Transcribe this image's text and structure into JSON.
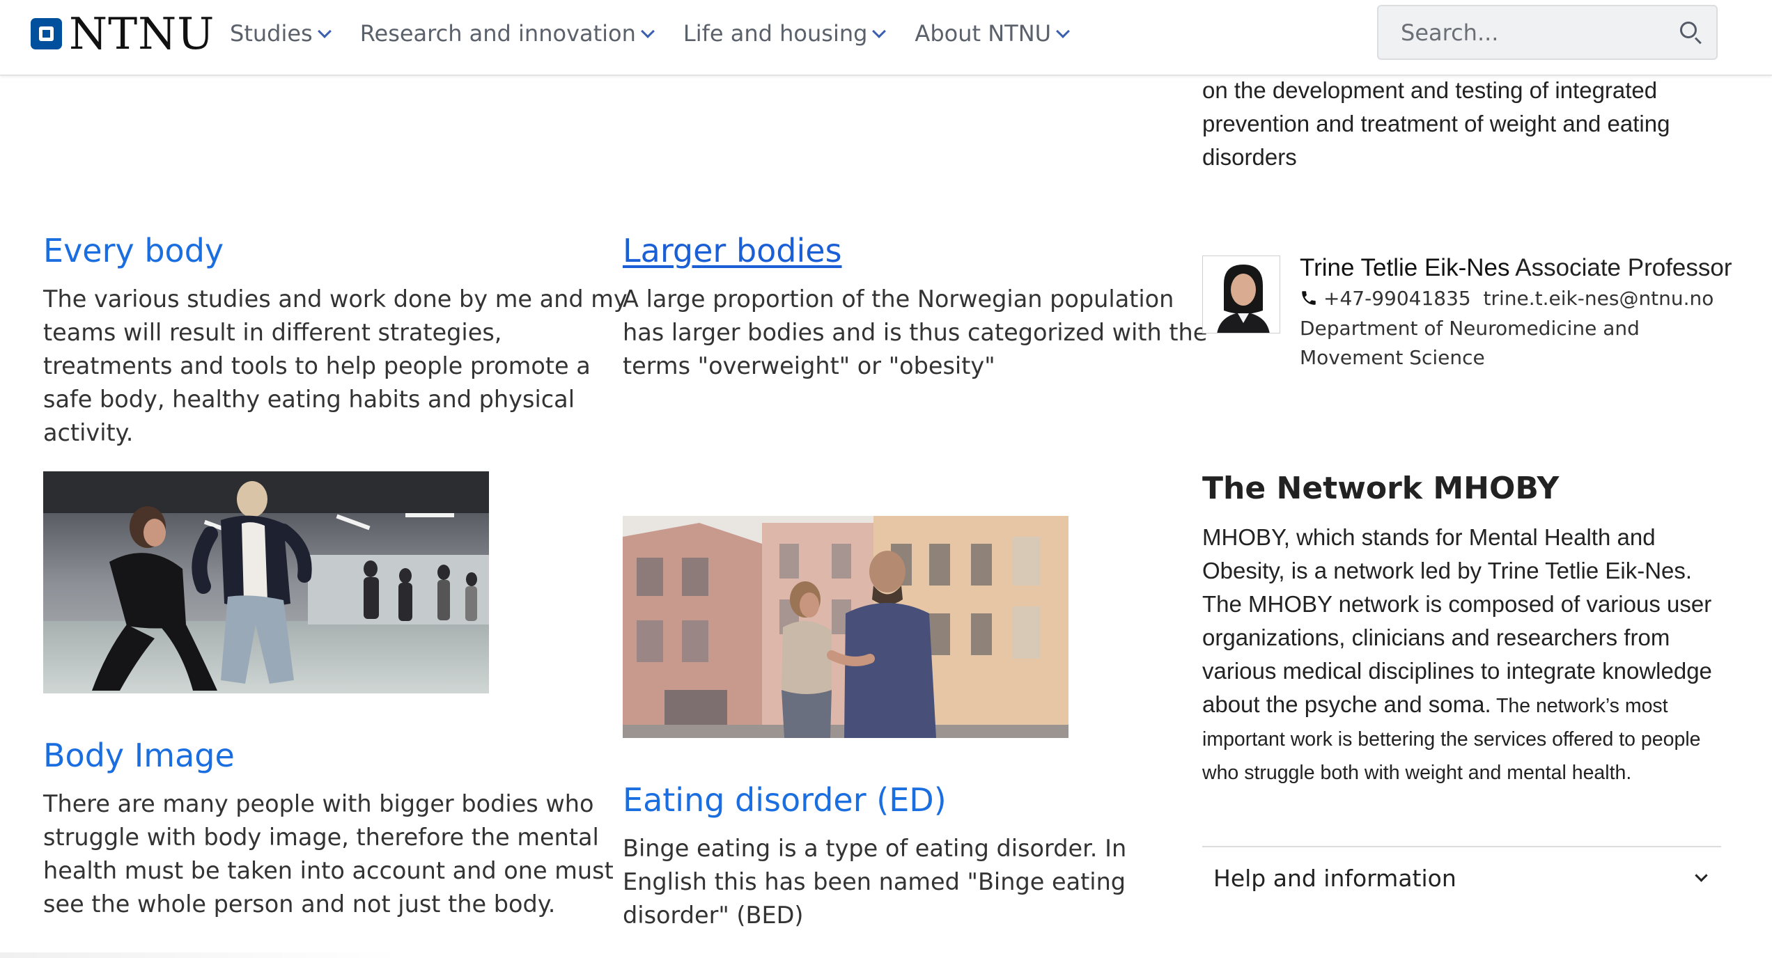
{
  "header": {
    "logo_text": "NTNU",
    "nav": [
      {
        "label": "Studies"
      },
      {
        "label": "Research and innovation"
      },
      {
        "label": "Life and housing"
      },
      {
        "label": "About NTNU"
      }
    ],
    "search": {
      "placeholder": "Search..."
    }
  },
  "intro_fragment": {
    "lines": [
      "on the development and testing of integrated",
      "prevention and treatment of weight and eating",
      "disorders"
    ]
  },
  "every_body": {
    "title": "Every body",
    "lines": [
      "The various studies and work done by me and my",
      "teams will result in different strategies,",
      "treatments and tools to help people promote a",
      "safe body, healthy eating habits and physical",
      "activity."
    ]
  },
  "larger_bodies": {
    "title": "Larger bodies",
    "lines": [
      "A large proportion of the Norwegian population",
      "has larger bodies and is thus categorized with the",
      "terms \"overweight\" or \"obesity\""
    ]
  },
  "body_image": {
    "title": "Body Image",
    "lines": [
      "There are many people with bigger bodies who",
      "struggle with body image, therefore the mental",
      "health must be taken into account and one must",
      "see the whole person and not just the body."
    ]
  },
  "eating_disorder": {
    "title": "Eating disorder (ED)",
    "lines": [
      "Binge eating is a type of eating disorder. In",
      "English this has been named \"Binge eating",
      "disorder\" (BED)"
    ]
  },
  "contact": {
    "name": "Trine Tetlie Eik-Nes",
    "title": " Associate Professor",
    "phone": "+47-99041835",
    "email": "trine.t.eik-nes@ntnu.no",
    "department_lines": [
      "Department of Neuromedicine and",
      "Movement Science"
    ]
  },
  "network": {
    "title": "The Network MHOBY",
    "lines": [
      "MHOBY, which stands for Mental Health and",
      "Obesity, is a network led by Trine Tetlie Eik-Nes.",
      "The MHOBY network is composed of various user",
      "organizations, clinicians and researchers from",
      "various medical disciplines to integrate knowledge"
    ],
    "mixed_line_a": "about the psyche and soma.",
    "mixed_line_b": " The network’s most",
    "small_lines": [
      "important work is bettering the services offered to people",
      "who struggle both with weight and mental health."
    ]
  },
  "help": {
    "label": "Help and information"
  },
  "colors": {
    "brand": "#00509e",
    "link": "#1a6ee0",
    "nav_text": "#5b616b"
  },
  "icons": [
    "search-icon",
    "chevron-down-icon",
    "phone-icon"
  ]
}
